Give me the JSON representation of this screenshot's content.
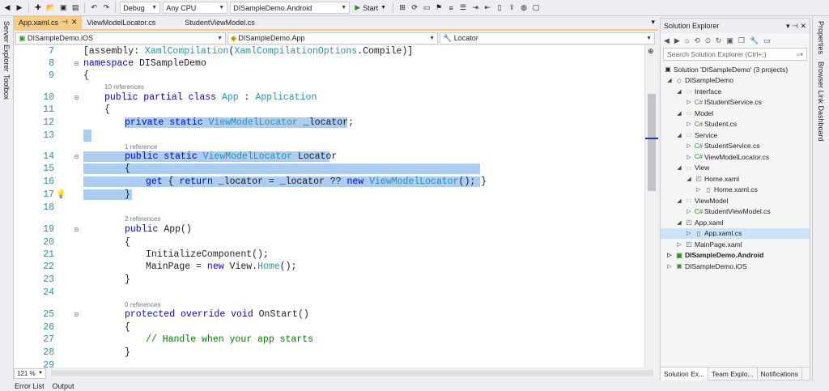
{
  "toolbar": {
    "config": "Debug",
    "platform": "Any CPU",
    "startup": "DISampleDemo.Android",
    "start": "Start"
  },
  "left_strip": {
    "server": "Server Explorer",
    "toolbox": "Toolbox"
  },
  "right_strip": {
    "properties": "Properties",
    "browser": "Browser Link Dashboard"
  },
  "tabs": [
    {
      "label": "App.xaml.cs"
    },
    {
      "label": "ViewModelLocator.cs"
    },
    {
      "label": "StudentViewModel.cs"
    }
  ],
  "nav": {
    "project": "DISampleDemo.iOS",
    "class": "DISampleDemo.App",
    "member": "Locator"
  },
  "code": {
    "l7": "7",
    "l8": "8",
    "l9": "9",
    "l10": "10",
    "l11": "11",
    "l12": "12",
    "l13": "13",
    "l14": "14",
    "l15": "15",
    "l16": "16",
    "l17": "17",
    "l18": "18",
    "l19": "19",
    "l20": "20",
    "l21": "21",
    "l22": "22",
    "l23": "23",
    "l24": "24",
    "l25": "25",
    "l26": "26",
    "l27": "27",
    "l28": "28",
    "l29": "29",
    "lens1": "10 references",
    "lens2": "1 reference",
    "lens3": "2 references",
    "lens4": "0 references"
  },
  "zoom": "121 %",
  "bottom": {
    "errors": "Error List",
    "output": "Output"
  },
  "solution_explorer": {
    "title": "Solution Explorer",
    "search": "Search Solution Explorer (Ctrl+;)",
    "items": [
      {
        "label": "Solution 'DISampleDemo' (3 projects)"
      },
      {
        "label": "DISampleDemo"
      },
      {
        "label": "Interface"
      },
      {
        "label": "IStudentService.cs"
      },
      {
        "label": "Model"
      },
      {
        "label": "Student.cs"
      },
      {
        "label": "Service"
      },
      {
        "label": "StudentService.cs"
      },
      {
        "label": "ViewModelLocator.cs"
      },
      {
        "label": "View"
      },
      {
        "label": "Home.xaml"
      },
      {
        "label": "Home.xaml.cs"
      },
      {
        "label": "ViewModel"
      },
      {
        "label": "StudentViewModel.cs"
      },
      {
        "label": "App.xaml"
      },
      {
        "label": "App.xaml.cs"
      },
      {
        "label": "MainPage.xaml"
      },
      {
        "label": "DISampleDemo.Android"
      },
      {
        "label": "DISampleDemo.iOS"
      }
    ],
    "tabs": [
      {
        "label": "Solution Ex..."
      },
      {
        "label": "Team Explo..."
      },
      {
        "label": "Notifications"
      }
    ]
  }
}
